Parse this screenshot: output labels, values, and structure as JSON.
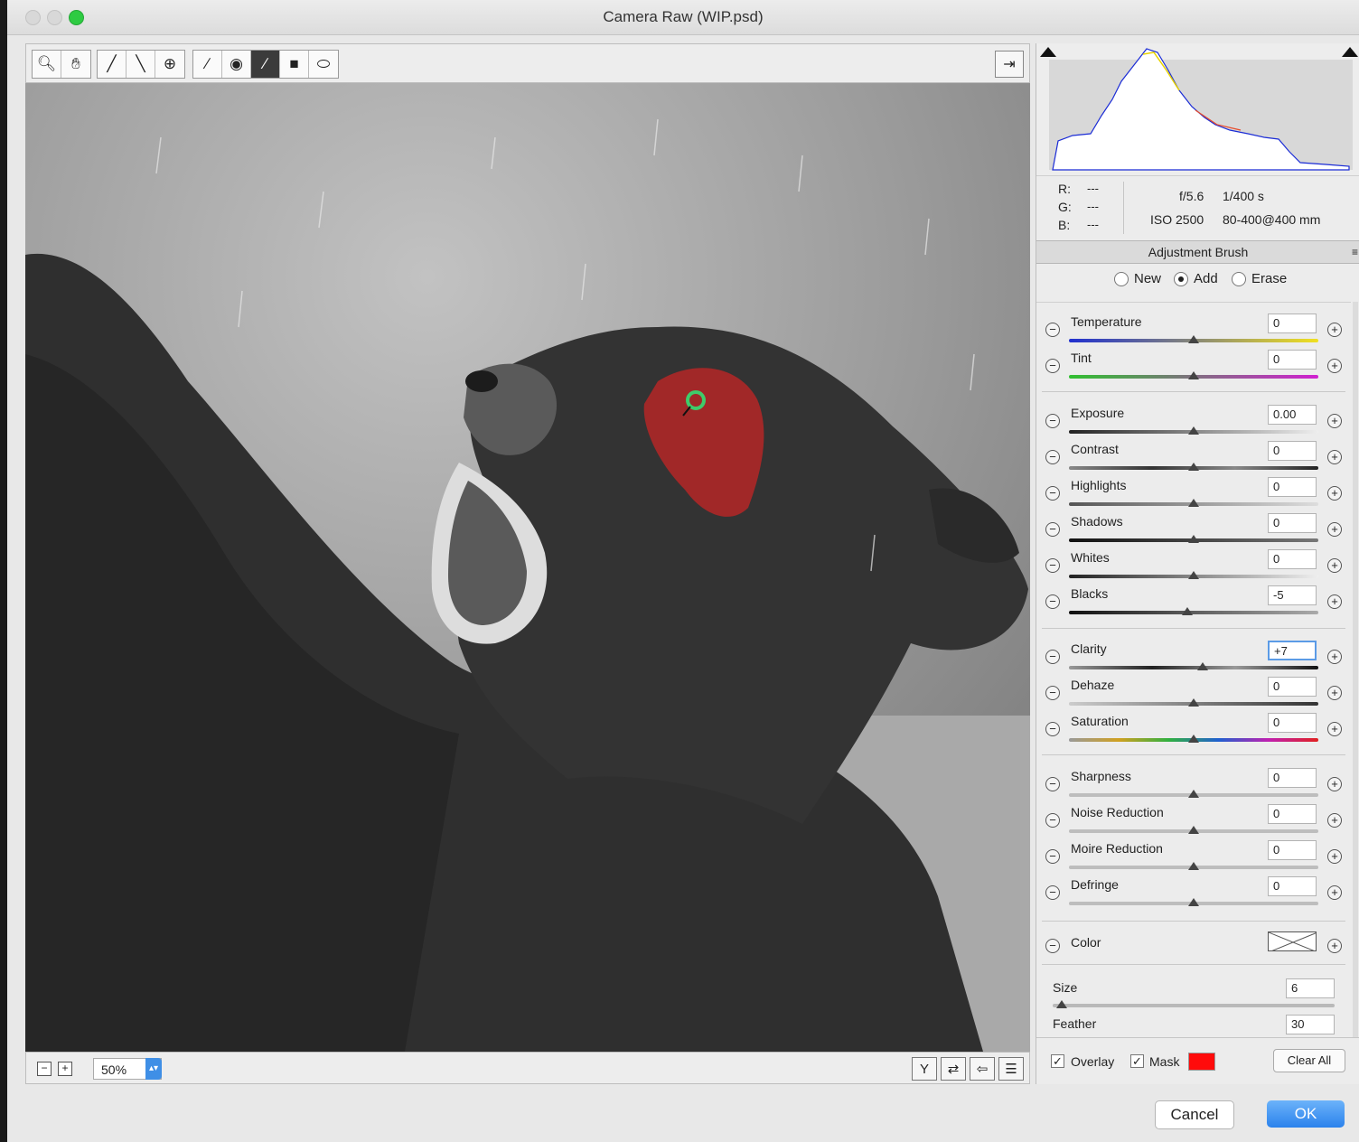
{
  "window": {
    "title": "Camera Raw (WIP.psd)"
  },
  "toolbar": {
    "tools": [
      "zoom-icon",
      "hand-icon",
      "white-balance-icon",
      "color-sampler-icon",
      "targeted-adjustment-icon",
      "straighten-icon",
      "red-eye-icon",
      "adjustment-brush-icon",
      "graduated-filter-icon",
      "radial-filter-icon"
    ],
    "active_tool": "adjustment-brush-icon"
  },
  "bottom": {
    "zoom": "50%"
  },
  "info": {
    "r_label": "R:",
    "g_label": "G:",
    "b_label": "B:",
    "r_value": "---",
    "g_value": "---",
    "b_value": "---",
    "aperture": "f/5.6",
    "shutter": "1/400 s",
    "iso": "ISO 2500",
    "lens": "80-400@400 mm"
  },
  "panel": {
    "title": "Adjustment Brush",
    "modes": [
      "New",
      "Add",
      "Erase"
    ],
    "selected_mode": "Add"
  },
  "sliders": [
    {
      "label": "Temperature",
      "value": "0",
      "position": 0.5
    },
    {
      "label": "Tint",
      "value": "0",
      "position": 0.5
    },
    {
      "label": "Exposure",
      "value": "0.00",
      "position": 0.5
    },
    {
      "label": "Contrast",
      "value": "0",
      "position": 0.5
    },
    {
      "label": "Highlights",
      "value": "0",
      "position": 0.5
    },
    {
      "label": "Shadows",
      "value": "0",
      "position": 0.5
    },
    {
      "label": "Whites",
      "value": "0",
      "position": 0.5
    },
    {
      "label": "Blacks",
      "value": "-5",
      "position": 0.475
    },
    {
      "label": "Clarity",
      "value": "+7",
      "position": 0.535
    },
    {
      "label": "Dehaze",
      "value": "0",
      "position": 0.5
    },
    {
      "label": "Saturation",
      "value": "0",
      "position": 0.5
    },
    {
      "label": "Sharpness",
      "value": "0",
      "position": 0.5
    },
    {
      "label": "Noise Reduction",
      "value": "0",
      "position": 0.5
    },
    {
      "label": "Moire Reduction",
      "value": "0",
      "position": 0.5
    },
    {
      "label": "Defringe",
      "value": "0",
      "position": 0.5
    }
  ],
  "color": {
    "label": "Color"
  },
  "brush": {
    "size_label": "Size",
    "size_value": "6",
    "feather_label": "Feather",
    "feather_value": "30"
  },
  "overlay": {
    "overlay_label": "Overlay",
    "mask_label": "Mask",
    "mask_color": "#ff0b0b",
    "clear_all": "Clear All"
  },
  "dialog": {
    "cancel": "Cancel",
    "ok": "OK"
  }
}
